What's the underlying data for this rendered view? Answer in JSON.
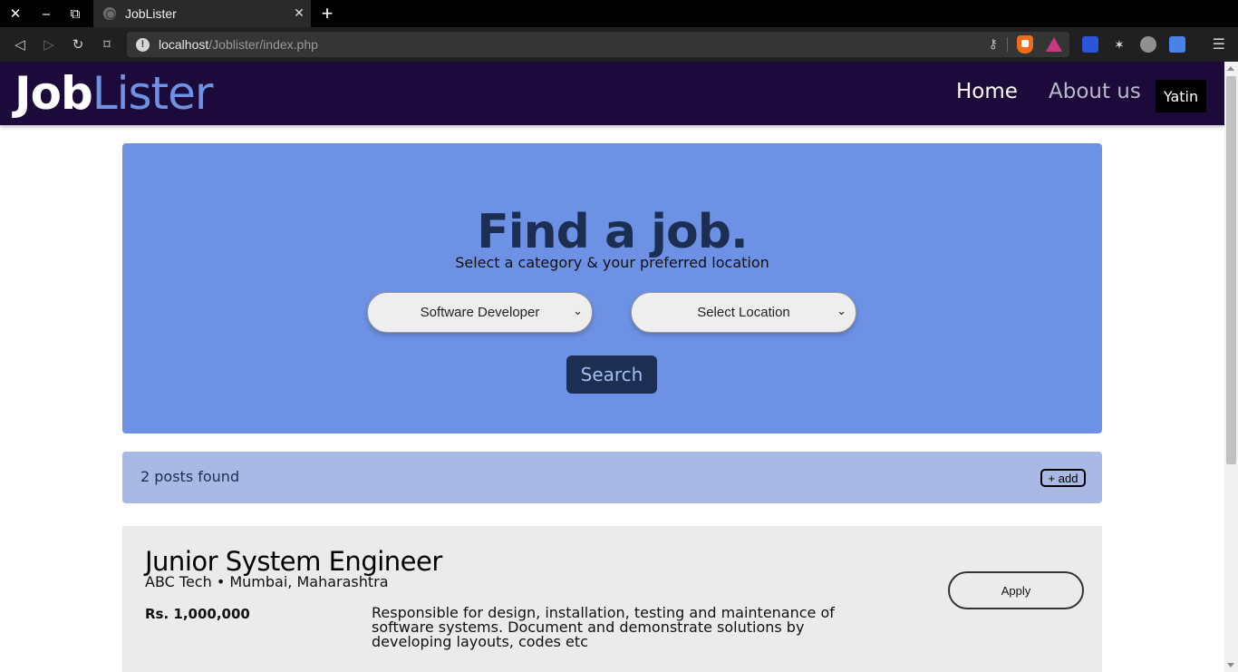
{
  "browser": {
    "tab_title": "JobLister",
    "new_tab": "+",
    "url_host": "localhost",
    "url_path": "/Joblister/index.php"
  },
  "header": {
    "logo_job": "Job",
    "logo_lister": "Lister",
    "nav": {
      "home": "Home",
      "about": "About us"
    },
    "user": "Yatin"
  },
  "hero": {
    "title": "Find a job.",
    "subtitle": "Select a category & your preferred location",
    "category_selected": "Software Developer",
    "location_selected": "Select Location",
    "search_label": "Search"
  },
  "results": {
    "count_text": "2 posts found",
    "add_label": "+ add"
  },
  "jobs": [
    {
      "title": "Junior System Engineer",
      "company": "ABC Tech",
      "separator": "•",
      "location": "Mumbai, Maharashtra",
      "salary": "Rs. 1,000,000",
      "description": "Responsible for design, installation, testing and maintenance of software systems. Document and demonstrate solutions by developing layouts, codes etc",
      "apply_label": "Apply"
    }
  ],
  "colors": {
    "header_bg": "#1c0b3a",
    "accent_blue": "#6d92e5",
    "dark_navy": "#1c2e52",
    "results_bg": "#a7b9e4",
    "card_bg": "#ebebeb"
  },
  "icons": {
    "window_close": "close-icon",
    "minimize": "minimize-icon",
    "restore": "restore-icon",
    "back": "back-icon",
    "forward": "forward-icon",
    "reload": "reload-icon",
    "bookmark": "bookmark-icon",
    "info": "info-icon",
    "key": "key-icon",
    "brave": "brave-shield-icon",
    "rewards": "brave-rewards-icon",
    "menu": "hamburger-menu-icon"
  }
}
